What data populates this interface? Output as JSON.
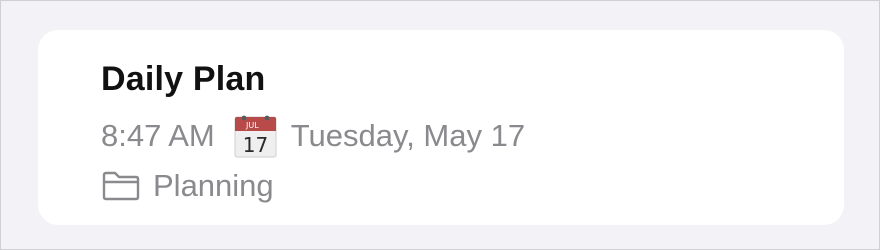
{
  "note": {
    "title": "Daily Plan",
    "time": "8:47 AM",
    "calendar_icon": {
      "name": "calendar-icon",
      "month": "JUL",
      "day": "17",
      "accent_color": "#b84a4a"
    },
    "date": "Tuesday, May 17",
    "folder_icon": "folder-icon",
    "folder": "Planning"
  },
  "colors": {
    "background": "#f2f2f7",
    "card": "#ffffff",
    "title": "#111111",
    "secondary_text": "#8a8a8e"
  }
}
